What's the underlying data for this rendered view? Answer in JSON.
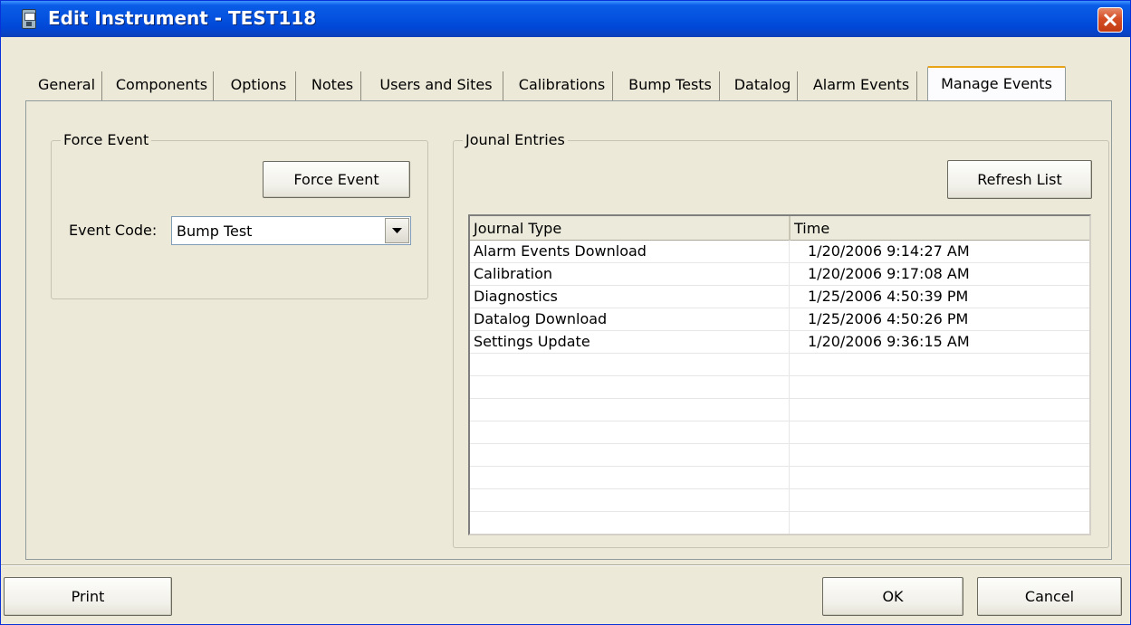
{
  "window": {
    "title": "Edit Instrument - TEST118"
  },
  "tabs": [
    {
      "label": "General"
    },
    {
      "label": "Components"
    },
    {
      "label": "Options"
    },
    {
      "label": "Notes"
    },
    {
      "label": "Users and Sites"
    },
    {
      "label": "Calibrations"
    },
    {
      "label": "Bump Tests"
    },
    {
      "label": "Datalog"
    },
    {
      "label": "Alarm Events"
    },
    {
      "label": "Manage Events",
      "active": true
    }
  ],
  "force_event": {
    "group_label": "Force Event",
    "button_label": "Force Event",
    "event_code_label": "Event Code:",
    "event_code_value": "Bump Test"
  },
  "journal": {
    "group_label": "Jounal Entries",
    "refresh_label": "Refresh List",
    "columns": [
      "Journal Type",
      "Time"
    ],
    "rows": [
      {
        "type": "Alarm Events Download",
        "time": "1/20/2006 9:14:27 AM"
      },
      {
        "type": "Calibration",
        "time": "1/20/2006 9:17:08 AM"
      },
      {
        "type": "Diagnostics",
        "time": "1/25/2006 4:50:39 PM"
      },
      {
        "type": "Datalog Download",
        "time": "1/25/2006 4:50:26 PM"
      },
      {
        "type": "Settings Update",
        "time": "1/20/2006 9:36:15 AM"
      }
    ]
  },
  "footer": {
    "print_label": "Print",
    "ok_label": "OK",
    "cancel_label": "Cancel"
  },
  "colors": {
    "title_bar": "#0553e0",
    "window_bg": "#ece9d8",
    "active_tab_accent": "#e8a317",
    "close_button": "#d54e25"
  },
  "icons": {
    "app": "instrument-icon",
    "close": "close-icon",
    "dropdown": "chevron-down-icon"
  }
}
